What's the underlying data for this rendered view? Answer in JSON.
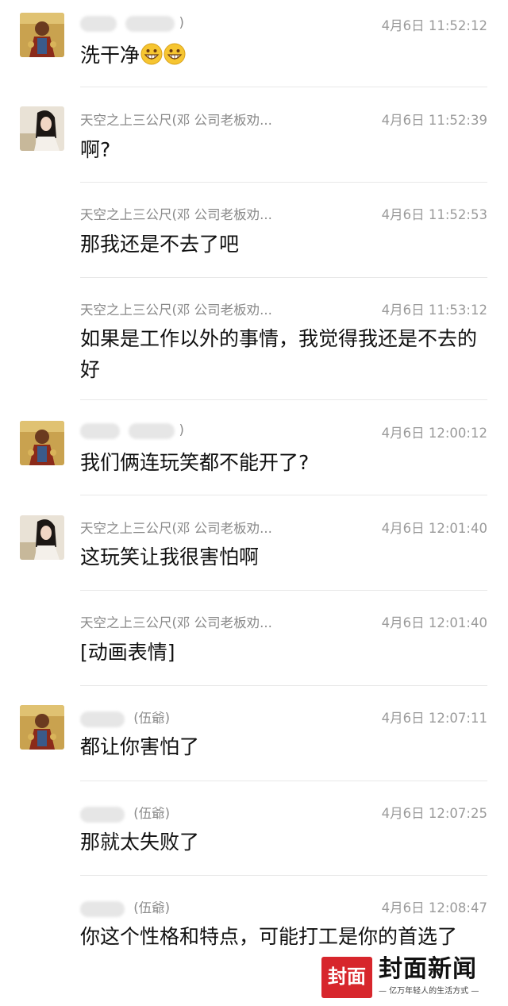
{
  "messages": [
    {
      "sender_suffix": ")",
      "time": "4月6日 11:52:12",
      "text": "洗干净",
      "emoji": [
        "grinning-emoji",
        "grinning-emoji"
      ],
      "avatar": "deity-figure-avatar"
    },
    {
      "sender": "天空之上三公尺(邓 公司老板劝...",
      "time": "4月6日 11:52:39",
      "text": "啊?",
      "avatar": "woman-portrait-avatar"
    },
    {
      "sender": "天空之上三公尺(邓 公司老板劝...",
      "time": "4月6日 11:52:53",
      "text": "那我还是不去了吧"
    },
    {
      "sender": "天空之上三公尺(邓 公司老板劝...",
      "time": "4月6日 11:53:12",
      "text": "如果是工作以外的事情，我觉得我还是不去的好"
    },
    {
      "sender_suffix": ")",
      "time": "4月6日 12:00:12",
      "text": "我们俩连玩笑都不能开了?",
      "avatar": "deity-figure-avatar"
    },
    {
      "sender": "天空之上三公尺(邓 公司老板劝...",
      "time": "4月6日 12:01:40",
      "text": "这玩笑让我很害怕啊",
      "avatar": "woman-portrait-avatar"
    },
    {
      "sender": "天空之上三公尺(邓 公司老板劝...",
      "time": "4月6日 12:01:40",
      "text": "[动画表情]"
    },
    {
      "sender_suffix": "(伍爺)",
      "time": "4月6日 12:07:11",
      "text": "都让你害怕了",
      "avatar": "deity-figure-avatar"
    },
    {
      "sender_suffix": "(伍爺)",
      "time": "4月6日 12:07:25",
      "text": "那就太失败了"
    },
    {
      "sender_suffix": "(伍爺)",
      "time": "4月6日 12:08:47",
      "text": "你这个性格和特点，可能打工是你的首选了"
    }
  ],
  "watermark": {
    "badge": "封面",
    "name": "封面新闻",
    "slogan": "— 亿万年轻人的生活方式 —",
    "color": "#d7262c"
  }
}
